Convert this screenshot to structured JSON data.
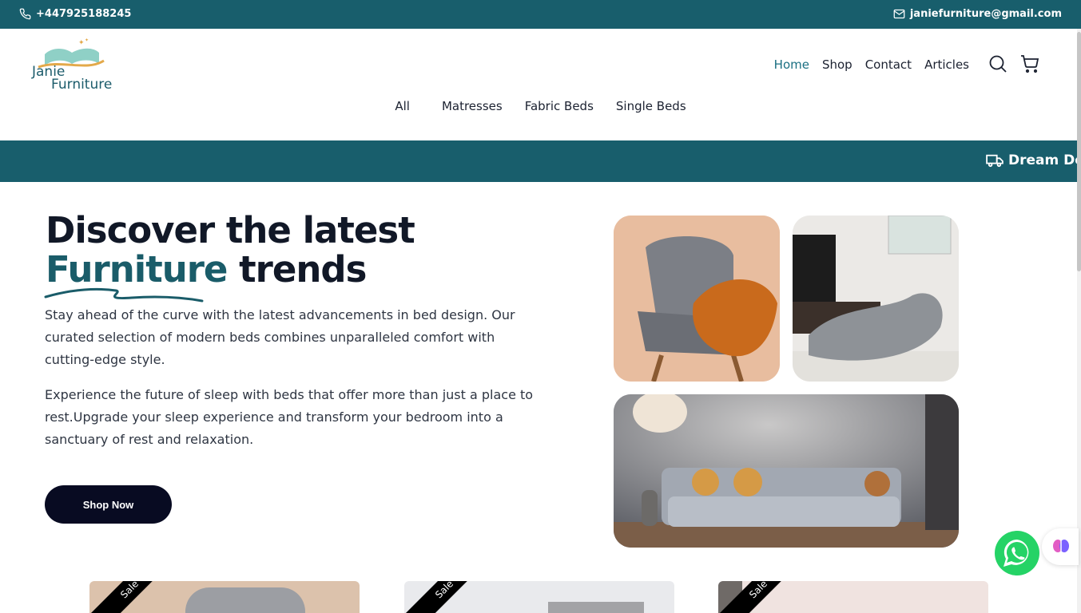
{
  "topbar": {
    "phone": "+447925188245",
    "email": "janiefurniture@gmail.com"
  },
  "logo": {
    "line1": "Janie",
    "line2": "Furniture"
  },
  "nav": {
    "items": [
      "Home",
      "Shop",
      "Contact",
      "Articles"
    ],
    "active": "Home",
    "icons": [
      "search-icon",
      "cart-icon"
    ]
  },
  "categories": [
    "All",
    "Matresses",
    "Fabric Beds",
    "Single Beds"
  ],
  "banner": {
    "text": "Dream Deals"
  },
  "hero": {
    "title_line1": "Discover the latest",
    "title_accent": "Furniture",
    "title_rest": " trends",
    "paragraph1": "Stay ahead of the curve with the latest advancements in bed design. Our curated selection of modern beds combines unparalleled comfort with cutting-edge style.",
    "paragraph2": "Experience the future of sleep with beds that offer more than just a place to rest.Upgrade your sleep experience and transform your bedroom into a sanctuary of rest and relaxation.",
    "cta": "Shop Now"
  },
  "products": [
    {
      "badge": "Sale"
    },
    {
      "badge": "Sale"
    },
    {
      "badge": "Sale"
    }
  ],
  "colors": {
    "primary": "#185e6c",
    "accent_text": "#1a5c69",
    "button": "#080b22",
    "whatsapp": "#25d366"
  }
}
